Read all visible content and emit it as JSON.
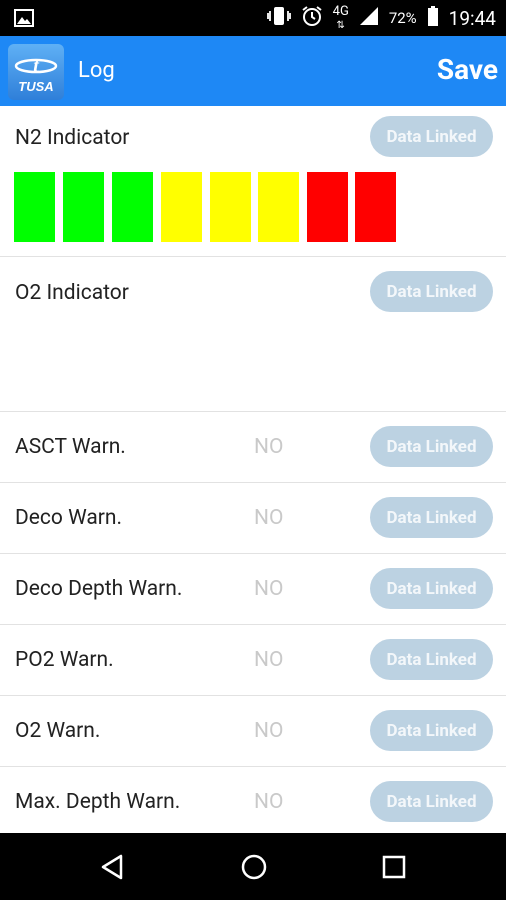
{
  "status_bar": {
    "left_icon": "image-icon",
    "network": "4G",
    "battery_percent": "72%",
    "time": "19:44",
    "icons": [
      "vibrate-icon",
      "alarm-icon",
      "network-4g-icon",
      "signal-icon",
      "battery-icon"
    ]
  },
  "app_bar": {
    "logo_text": "TUSA",
    "title": "Log",
    "save_label": "Save",
    "color": "#1e88f5"
  },
  "n2": {
    "label": "N2 Indicator",
    "button": "Data Linked",
    "bars": [
      "#00ff00",
      "#00ff00",
      "#00ff00",
      "#ffff00",
      "#ffff00",
      "#ffff00",
      "#ff0000",
      "#ff0000"
    ]
  },
  "o2": {
    "label": "O2 Indicator",
    "button": "Data Linked"
  },
  "warnings": [
    {
      "label": "ASCT Warn.",
      "value": "NO",
      "button": "Data Linked"
    },
    {
      "label": "Deco Warn.",
      "value": "NO",
      "button": "Data Linked"
    },
    {
      "label": "Deco Depth Warn.",
      "value": "NO",
      "button": "Data Linked"
    },
    {
      "label": "PO2 Warn.",
      "value": "NO",
      "button": "Data Linked"
    },
    {
      "label": "O2 Warn.",
      "value": "NO",
      "button": "Data Linked"
    },
    {
      "label": "Max. Depth Warn.",
      "value": "NO",
      "button": "Data Linked"
    }
  ],
  "nav": {
    "icons": [
      "back-icon",
      "home-icon",
      "recents-icon"
    ]
  }
}
